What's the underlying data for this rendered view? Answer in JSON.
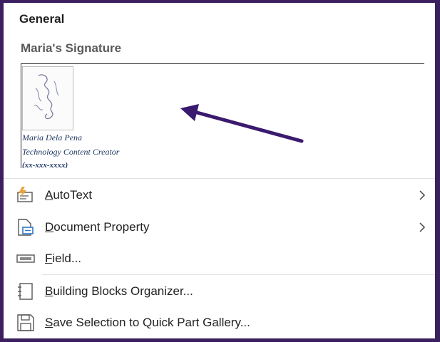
{
  "gallery": {
    "header": "General",
    "entry": {
      "title": "Maria's Signature",
      "lines": [
        "Maria Dela Pena",
        "Technology Content Creator",
        "(xx-xxx-xxxx)"
      ]
    }
  },
  "menu": {
    "autotext": {
      "mn": "A",
      "rest": "utoText",
      "icon": "autotext-lightning-icon",
      "submenu": true
    },
    "docprop": {
      "mn": "D",
      "rest": "ocument Property",
      "icon": "document-property-icon",
      "submenu": true
    },
    "field": {
      "mn": "F",
      "rest": "ield...",
      "icon": "field-icon",
      "submenu": false
    },
    "organizer": {
      "mn": "B",
      "rest": "uilding Blocks Organizer...",
      "icon": "building-blocks-icon",
      "submenu": false
    },
    "save": {
      "mn": "S",
      "rest": "ave Selection to Quick Part Gallery...",
      "icon": "save-icon",
      "submenu": false
    }
  },
  "colors": {
    "frame": "#3b1f5e",
    "arrow": "#3a1a6e",
    "signature_text": "#1f3864",
    "icon_blue": "#2b78c5",
    "icon_orange": "#e8a33d"
  }
}
